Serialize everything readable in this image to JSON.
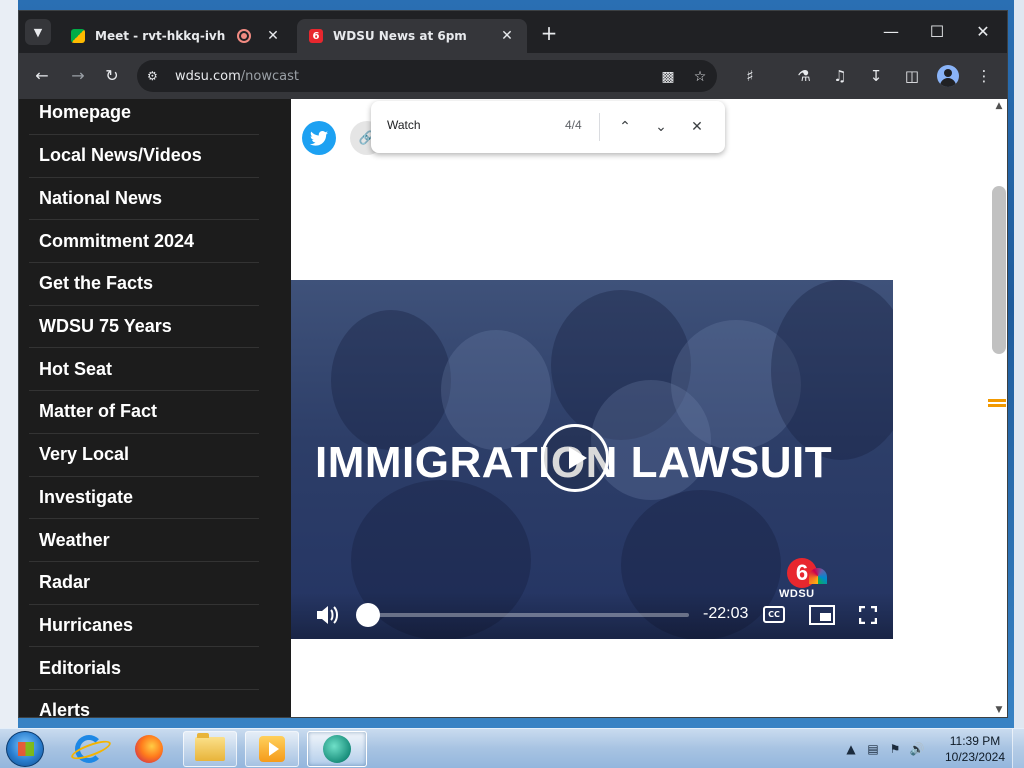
{
  "browser": {
    "tabs": [
      {
        "title": "Meet - rvt-hkkq-ivh",
        "recording": true,
        "active": false
      },
      {
        "title": "WDSU News at 6pm",
        "active": true
      }
    ],
    "new_tab_icon": "plus-icon",
    "window_controls": [
      "minimize-icon",
      "maximize-icon",
      "close-icon"
    ],
    "address": {
      "host": "wdsu.com",
      "path": "/nowcast"
    }
  },
  "sidebar": {
    "items": [
      {
        "label": "Homepage"
      },
      {
        "label": "Local News/Videos"
      },
      {
        "label": "National News"
      },
      {
        "label": "Commitment 2024"
      },
      {
        "label": "Get the Facts"
      },
      {
        "label": "WDSU 75 Years"
      },
      {
        "label": "Hot Seat"
      },
      {
        "label": "Matter of Fact"
      },
      {
        "label": "Very Local"
      },
      {
        "label": "Investigate"
      },
      {
        "label": "Weather"
      },
      {
        "label": "Radar"
      },
      {
        "label": "Hurricanes"
      },
      {
        "label": "Editorials"
      },
      {
        "label": "Alerts"
      }
    ]
  },
  "find_bar": {
    "query": "Watch",
    "count": "4/4"
  },
  "video": {
    "headline": "IMMIGRATION LAWSUIT",
    "logo_text": "WDSU",
    "logo_number": "6",
    "time_remaining": "-22:03",
    "cc_label": "CC",
    "progress": 0.0
  },
  "taskbar": {
    "apps": [
      "internet-explorer",
      "firefox",
      "file-explorer",
      "media-player",
      "chat-app"
    ],
    "clock": {
      "time": "11:39 PM",
      "date": "10/23/2024"
    }
  }
}
